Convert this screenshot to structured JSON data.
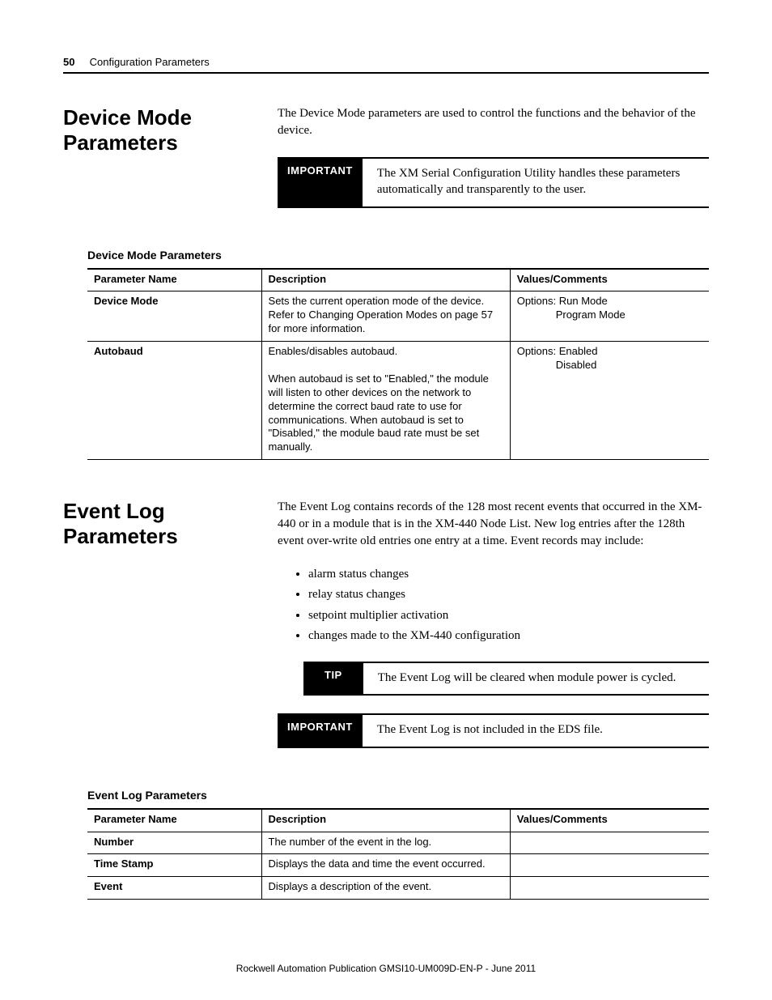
{
  "page": {
    "number": "50",
    "chapter": "Configuration Parameters"
  },
  "section1": {
    "title": "Device Mode Parameters",
    "intro": "The Device Mode parameters are used to control the functions and the behavior of the device.",
    "important": "The XM Serial Configuration Utility handles these parameters automatically and transparently to the user.",
    "table_caption": "Device Mode Parameters",
    "headers": {
      "c1": "Parameter Name",
      "c2": "Description",
      "c3": "Values/Comments"
    },
    "rows": [
      {
        "name": "Device Mode",
        "desc": "Sets the current operation mode of the device. Refer to Changing Operation Modes on page 57 for more information.",
        "val_line1": "Options: Run Mode",
        "val_line2": "Program Mode"
      },
      {
        "name": "Autobaud",
        "desc_line1": "Enables/disables autobaud.",
        "desc_line2": "When autobaud is set to \"Enabled,\" the module will listen to other devices on the network to determine the correct baud rate to use for communications. When autobaud is set to \"Disabled,\" the module baud rate must be set manually.",
        "val_line1": "Options: Enabled",
        "val_line2": "Disabled"
      }
    ]
  },
  "section2": {
    "title": "Event Log Parameters",
    "intro": "The Event Log contains records of the 128 most recent events that occurred in the XM-440 or in a module that is in the XM-440 Node List. New log entries after the 128th event over-write old entries one entry at a time. Event records may include:",
    "bullets": [
      "alarm status changes",
      "relay status changes",
      "setpoint multiplier activation",
      "changes made to the XM-440 configuration"
    ],
    "tip": "The Event Log will be cleared when module power is cycled.",
    "important": "The Event Log is not included in the EDS file.",
    "table_caption": "Event Log Parameters",
    "headers": {
      "c1": "Parameter Name",
      "c2": "Description",
      "c3": "Values/Comments"
    },
    "rows": [
      {
        "name": "Number",
        "desc": "The number of the event in the log.",
        "val": ""
      },
      {
        "name": "Time Stamp",
        "desc": "Displays the data and time the event occurred.",
        "val": ""
      },
      {
        "name": "Event",
        "desc": "Displays a description of the event.",
        "val": ""
      }
    ]
  },
  "labels": {
    "important": "IMPORTANT",
    "tip": "TIP"
  },
  "footer": "Rockwell Automation Publication GMSI10-UM009D-EN-P - June 2011"
}
